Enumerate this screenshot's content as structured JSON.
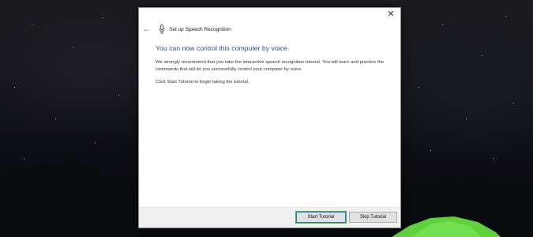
{
  "window": {
    "title": "Set up Speech Recognition",
    "close_glyph": "✕",
    "back_glyph": "←"
  },
  "content": {
    "heading": "You can now control this computer by voice.",
    "paragraph1": "We strongly recommend that you take the interactive speech recognition tutorial. You will learn and practice the commands that will let you successfully control your computer by voice.",
    "paragraph2": "Click Start Tutorial to begin taking the tutorial."
  },
  "footer": {
    "start_label": "Start Tutorial",
    "skip_label": "Skip Tutorial"
  },
  "icons": {
    "close": "close-icon",
    "back": "back-arrow-icon",
    "microphone": "microphone-icon"
  },
  "colors": {
    "heading": "#1f4e9c",
    "focus_ring": "#4fb33a",
    "tent": "#5fd13a"
  }
}
